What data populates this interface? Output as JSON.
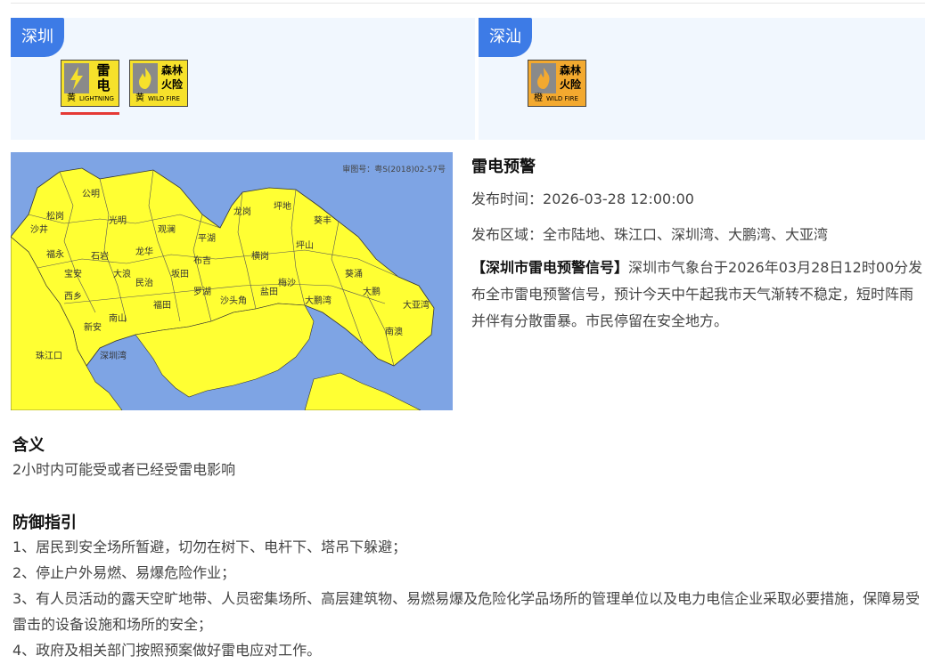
{
  "regions": [
    {
      "name": "深圳",
      "warnings": [
        {
          "cn": "雷电",
          "level": "黄",
          "en": "LIGHTNING",
          "icon": "lightning-icon",
          "color": "#f6e12b",
          "active": true
        },
        {
          "cn": "森林火险",
          "level": "黄",
          "en": "WILD FIRE",
          "icon": "fire-icon",
          "color": "#f6e12b",
          "active": false
        }
      ]
    },
    {
      "name": "深汕",
      "warnings": [
        {
          "cn": "森林火险",
          "level": "橙",
          "en": "WILD FIRE",
          "icon": "fire-icon",
          "color": "#f3a92f",
          "active": false
        }
      ]
    }
  ],
  "map": {
    "approval": "审图号：粤S(2018)02-57号",
    "labels": [
      "龙岗",
      "坪地",
      "大鹏湾",
      "大亚湾",
      "大鹏",
      "南澳",
      "葵涌",
      "珠江口",
      "深圳湾",
      "公明",
      "光明",
      "松岗",
      "沙井",
      "福永",
      "西乡",
      "龙华",
      "观澜",
      "布吉",
      "平湖",
      "横岗",
      "盐田",
      "南山",
      "福田",
      "罗湖",
      "沙头角",
      "坂田",
      "民治",
      "石岩",
      "新安",
      "宝安",
      "大浪",
      "坪山",
      "梅沙",
      "葵丰"
    ]
  },
  "detail": {
    "title": "雷电预警",
    "publish_time_label": "发布时间：",
    "publish_time": "2026-03-28 12:00:00",
    "area_label": "发布区域：",
    "area": "全市陆地、珠江口、深圳湾、大鹏湾、大亚湾",
    "signal_title": "【深圳市雷电预警信号】",
    "signal_text": "深圳市气象台于2026年03月28日12时00分发布全市雷电预警信号，预计今天中午起我市天气渐转不稳定，短时阵雨并伴有分散雷暴。市民停留在安全地方。"
  },
  "meaning": {
    "title": "含义",
    "text": "2小时内可能受或者已经受雷电影响"
  },
  "guide": {
    "title": "防御指引",
    "items": [
      "1、居民到安全场所暂避，切勿在树下、电杆下、塔吊下躲避；",
      "2、停止户外易燃、易爆危险作业；",
      "3、有人员活动的露天空旷地带、人员密集场所、高层建筑物、易燃易爆及危险化学品场所的管理单位以及电力电信企业采取必要措施，保障易受雷击的设备设施和场所的安全；",
      "4、政府及相关部门按照预案做好雷电应对工作。"
    ]
  },
  "colors": {
    "accent": "#3d7be6",
    "panel_bg": "#f1f7fe",
    "active_underline": "#e53935",
    "map_water": "#7ea4e4",
    "map_land": "#ffff33"
  }
}
